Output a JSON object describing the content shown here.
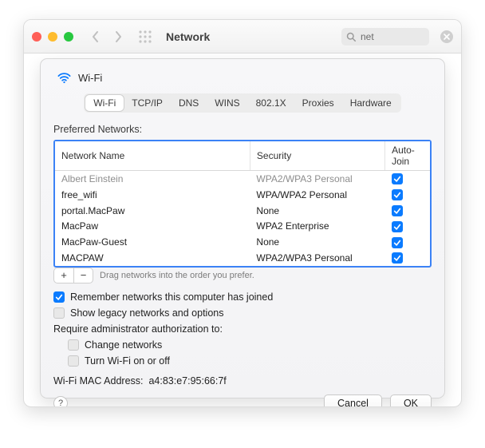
{
  "window": {
    "title": "Network",
    "search_value": "net"
  },
  "panel": {
    "title": "Wi-Fi"
  },
  "tabs": [
    {
      "label": "Wi-Fi",
      "active": true
    },
    {
      "label": "TCP/IP",
      "active": false
    },
    {
      "label": "DNS",
      "active": false
    },
    {
      "label": "WINS",
      "active": false
    },
    {
      "label": "802.1X",
      "active": false
    },
    {
      "label": "Proxies",
      "active": false
    },
    {
      "label": "Hardware",
      "active": false
    }
  ],
  "networks": {
    "section_label": "Preferred Networks:",
    "columns": {
      "name": "Network Name",
      "security": "Security",
      "auto": "Auto-Join"
    },
    "rows": [
      {
        "name": "Albert Einstein",
        "security": "WPA2/WPA3 Personal",
        "auto": true,
        "faded": true
      },
      {
        "name": "free_wifi",
        "security": "WPA/WPA2 Personal",
        "auto": true,
        "faded": false
      },
      {
        "name": "portal.MacPaw",
        "security": "None",
        "auto": true,
        "faded": false
      },
      {
        "name": "MacPaw",
        "security": "WPA2 Enterprise",
        "auto": true,
        "faded": false
      },
      {
        "name": "MacPaw-Guest",
        "security": "None",
        "auto": true,
        "faded": false
      },
      {
        "name": "MACPAW",
        "security": "WPA2/WPA3 Personal",
        "auto": true,
        "faded": false
      }
    ],
    "drag_hint": "Drag networks into the order you prefer.",
    "add_label": "+",
    "remove_label": "−"
  },
  "options": {
    "remember": {
      "label": "Remember networks this computer has joined",
      "checked": true
    },
    "legacy": {
      "label": "Show legacy networks and options",
      "checked": false
    },
    "require_label": "Require administrator authorization to:",
    "change": {
      "label": "Change networks",
      "checked": false
    },
    "toggle": {
      "label": "Turn Wi-Fi on or off",
      "checked": false
    }
  },
  "mac": {
    "label": "Wi-Fi MAC Address:",
    "value": "a4:83:e7:95:66:7f"
  },
  "footer": {
    "help": "?",
    "cancel": "Cancel",
    "ok": "OK"
  }
}
